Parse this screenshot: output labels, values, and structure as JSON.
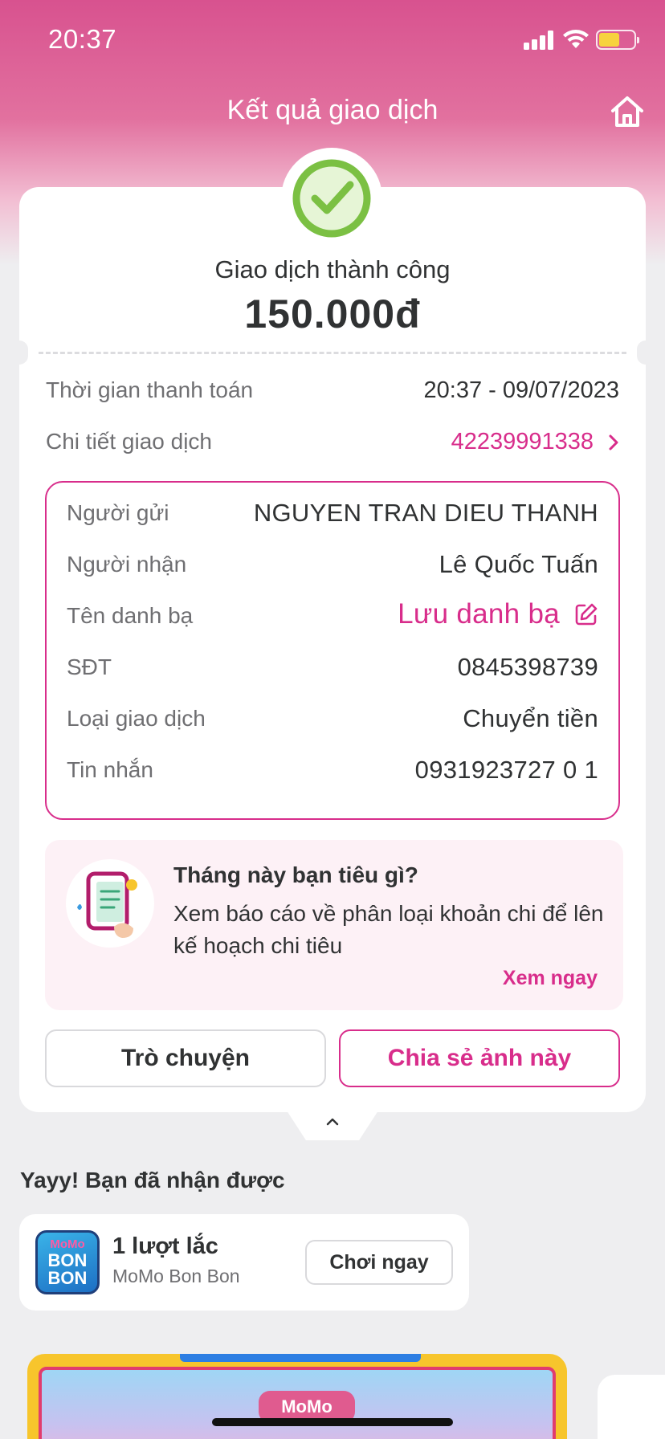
{
  "status_bar": {
    "time": "20:37"
  },
  "header": {
    "title": "Kết quả giao dịch"
  },
  "result": {
    "status_text": "Giao dịch thành công",
    "amount": "150.000đ"
  },
  "summary": {
    "time_label": "Thời gian thanh toán",
    "time_value": "20:37 - 09/07/2023",
    "detail_label": "Chi tiết giao dịch",
    "detail_value": "42239991338"
  },
  "details": {
    "sender_label": "Người gửi",
    "sender_value": "NGUYEN TRAN DIEU THANH",
    "receiver_label": "Người nhận",
    "receiver_value": "Lê Quốc Tuấn",
    "contact_label": "Tên danh bạ",
    "contact_value": "Lưu danh bạ",
    "phone_label": "SĐT",
    "phone_value": "0845398739",
    "type_label": "Loại giao dịch",
    "type_value": "Chuyển tiền",
    "message_label": "Tin nhắn",
    "message_value": "0931923727 0 1"
  },
  "promo": {
    "title": "Tháng này bạn tiêu gì?",
    "description": "Xem báo cáo về phân loại khoản chi để lên kế hoạch chi tiêu",
    "link": "Xem ngay"
  },
  "actions": {
    "chat_label": "Trò chuyện",
    "share_label": "Chia sẻ ảnh này"
  },
  "reward": {
    "heading": "Yayy! Bạn đã nhận được",
    "title": "1 lượt lắc",
    "subtitle": "MoMo Bon Bon",
    "button": "Chơi ngay",
    "logo_top": "MoMo",
    "logo_main": "BON BON"
  },
  "banner": {
    "logo_text": "MoMo"
  },
  "colors": {
    "brand": "#d82d8b",
    "success": "#7bc043",
    "text": "#303233",
    "muted": "#6f6f72"
  }
}
